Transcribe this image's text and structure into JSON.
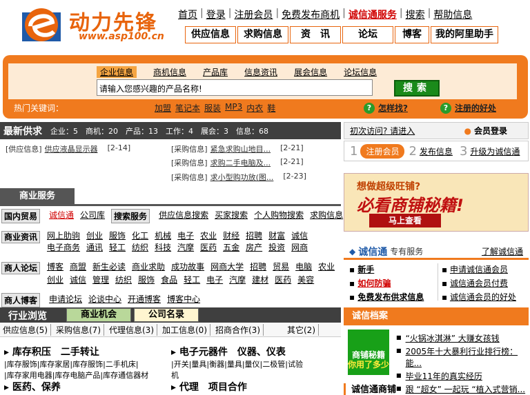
{
  "header": {
    "logo_cn": "动力先锋",
    "logo_url": "www.asp100.cn",
    "topnav": [
      "首页",
      "登录",
      "注册会员",
      "免费发布商机",
      "诚信通服务",
      "搜索",
      "帮助信息"
    ],
    "subnav": [
      "供应信息",
      "求购信息",
      "资　讯",
      "论坛",
      "博客",
      "我的阿里助手"
    ]
  },
  "search": {
    "tabs": [
      "企业信息",
      "商机信息",
      "产品库",
      "信息资讯",
      "展会信息",
      "论坛信息"
    ],
    "placeholder": "请输入您感兴趣的产品名称!",
    "button": "搜索",
    "hot_label": "热门关键词：",
    "hot_words": [
      "加盟",
      "笔记本",
      "服装",
      "MP3",
      "内衣",
      "鞋"
    ],
    "help1": "怎样找?",
    "help2": "注册的好处"
  },
  "latest": {
    "title": "最新供求",
    "stats": [
      "企业：5",
      "商机：20",
      "产品：13",
      "工作：4",
      "展会：3",
      "信息：68"
    ],
    "left": [
      {
        "tag": "[供应信息]",
        "text": "供应液晶显示器",
        "date": "[2-14]"
      }
    ],
    "right": [
      {
        "tag": "[采购信息]",
        "text": "紧急求购山地目...",
        "date": "[2-21]"
      },
      {
        "tag": "[采购信息]",
        "text": "求购二手电脑及...",
        "date": "[2-21]"
      },
      {
        "tag": "[采购信息]",
        "text": "求小型购功放(图...",
        "date": "[2-23]"
      }
    ]
  },
  "login": {
    "first_visit": "初次访问? 请进入",
    "member_login": "会员登录",
    "step1": "注册会员",
    "step2": "发布信息",
    "step3": "升级为诚信通"
  },
  "services": {
    "title": "商业服务",
    "trade_label": "国内贸易",
    "trade_items": [
      "诚信通",
      "公司库"
    ],
    "search_label": "搜索服务",
    "search_items": [
      "供应信息搜索",
      "买家搜索",
      "个人购物搜索",
      "求购信息"
    ],
    "news_label": "商业资讯",
    "news_row1": [
      "网上肋驹",
      "创业",
      "服饰",
      "化工",
      "机械",
      "电子",
      "农业",
      "财经",
      "招聘",
      "财富",
      "诚信"
    ],
    "news_row2": [
      "电子商务",
      "通讯",
      "轻工",
      "纺织",
      "科技",
      "汽摩",
      "医药",
      "五金",
      "房产",
      "投资",
      "网商"
    ],
    "forum_label": "商人论坛",
    "forum_row1": [
      "博客",
      "商盟",
      "新生必读",
      "商业求助",
      "成功故事",
      "网商大学",
      "招聘",
      "贸易",
      "电脑",
      "农业"
    ],
    "forum_row2": [
      "创业",
      "诚信",
      "管理",
      "纺织",
      "服饰",
      "食品",
      "轻工",
      "电子",
      "汽摩",
      "建材",
      "医药",
      "美容"
    ],
    "blog_label": "商人博客",
    "blog_items": [
      "申请论坛",
      "论谈中心",
      "开通博客",
      "博客中心"
    ]
  },
  "industry": {
    "title": "行业浏览",
    "tab1": "商业机会",
    "tab2": "公司名录",
    "cats": [
      "供应信息(5)",
      "采购信息(7)",
      "代理信息(3)",
      "加工信息(0)",
      "招商合作(3)",
      "其它(2)"
    ],
    "block1_title": "库存积压　二手转让",
    "block1_l1": "|库存服饰|库存家居|库存服饰|二手机床|",
    "block1_l2": "|库存家用电器|库存电脑产品|库存通信器材",
    "block2_title": "电子元器件　仪器、仪表",
    "block2_l1": "|开关|量具|衡器|量具|量仪|二极管|试验",
    "block2_l2": "机",
    "block3_title": "医药、保养",
    "block4_title": "代理　项目合作"
  },
  "right": {
    "banner_top": "想做超级旺铺?",
    "banner_main": "必看商铺秘籍!",
    "banner_btn": "马上查看",
    "cxt_title": "诚信通",
    "cxt_sub": "专有服务",
    "cxt_link": "了解诚信通",
    "left_items": [
      "新手",
      "如何防骗",
      "免费发布供求信息"
    ],
    "right_items": [
      "申请诚信通会员",
      "诚信通会员付费",
      "诚信通会员的好处"
    ],
    "dangan_title": "诚信档案",
    "promo_line1": "商铺秘籍",
    "promo_line2": "你用了多少",
    "news": [
      "“火锅冰淇淋” 大赚女孩钱",
      "2005年十大暴利行业排行榜：能...",
      "毕业11年的真实经历",
      "跟 “超女” 一起玩 “植入式营销..."
    ],
    "cxsb": "诚信通商铺"
  },
  "colors": {
    "accent": "#f07a1e",
    "green": "#1a8a1a",
    "dark": "#3f3f3f",
    "red": "#d00000"
  }
}
